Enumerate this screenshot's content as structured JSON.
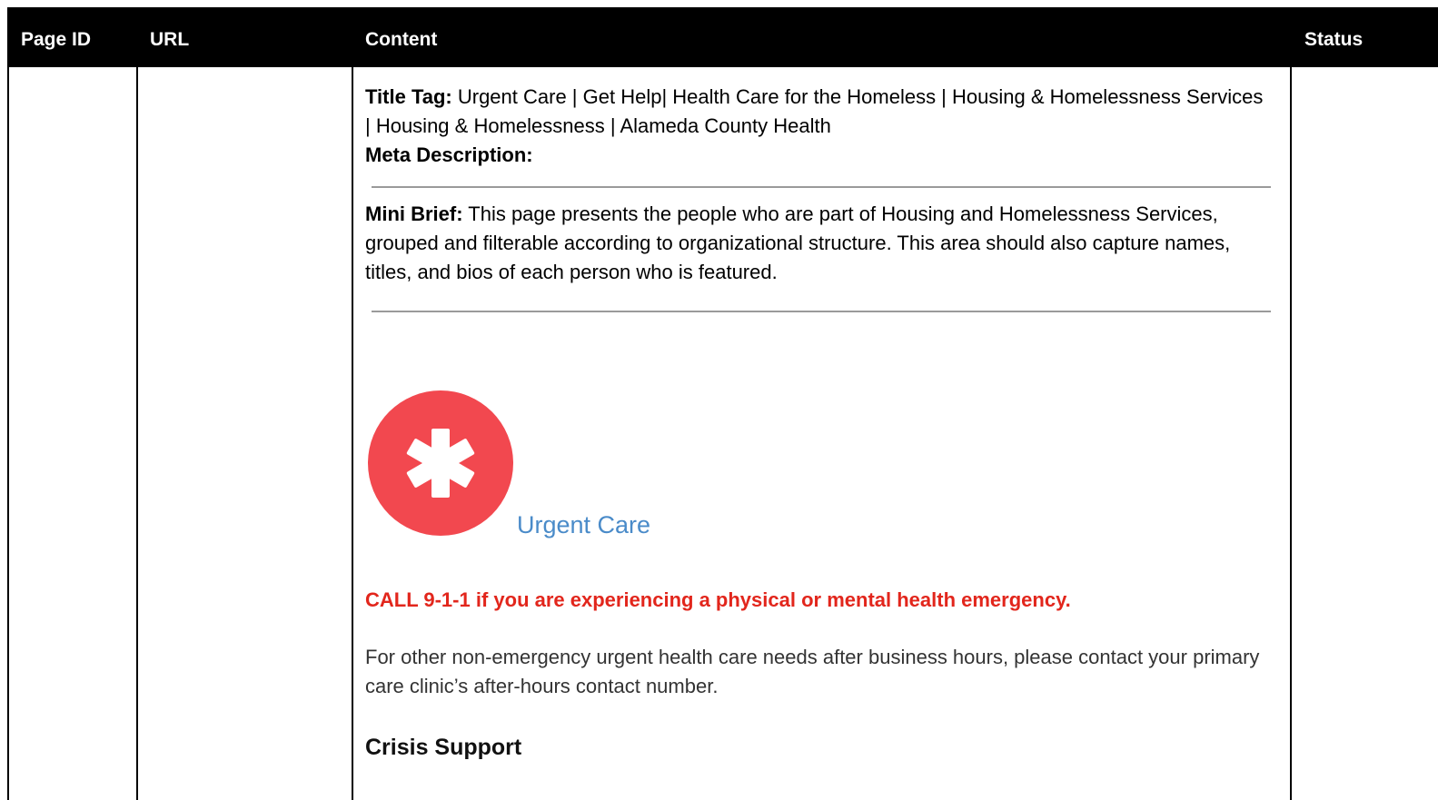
{
  "table": {
    "headers": {
      "page_id": "Page ID",
      "url": "URL",
      "content": "Content",
      "status": "Status"
    }
  },
  "content": {
    "title_tag_label": "Title Tag:",
    "title_tag_value": " Urgent Care | Get Help| Health Care for the Homeless | Housing & Homelessness Services | Housing & Homelessness | Alameda County Health",
    "meta_description_label": "Meta Description:",
    "mini_brief_label": "Mini Brief:",
    "mini_brief_value": " This page presents the people who are part of Housing and Homelessness Services, grouped and filterable according to organizational structure. This area should also capture names, titles, and bios of each person who is featured.",
    "urgent_care_link": "Urgent Care",
    "emergency_notice": "CALL 9-1-1 if you are experiencing a physical or mental health emergency.",
    "non_emergency_text": "For other non-emergency urgent health care needs after business hours, please contact your primary care clinic’s after-hours contact number.",
    "crisis_heading": "Crisis Support"
  },
  "colors": {
    "header_bg": "#000000",
    "icon_red": "#f2484f",
    "link_blue": "#4a8bc9",
    "emergency_red": "#e2261c"
  },
  "icons": {
    "urgent_care": "medical-asterisk-icon"
  }
}
